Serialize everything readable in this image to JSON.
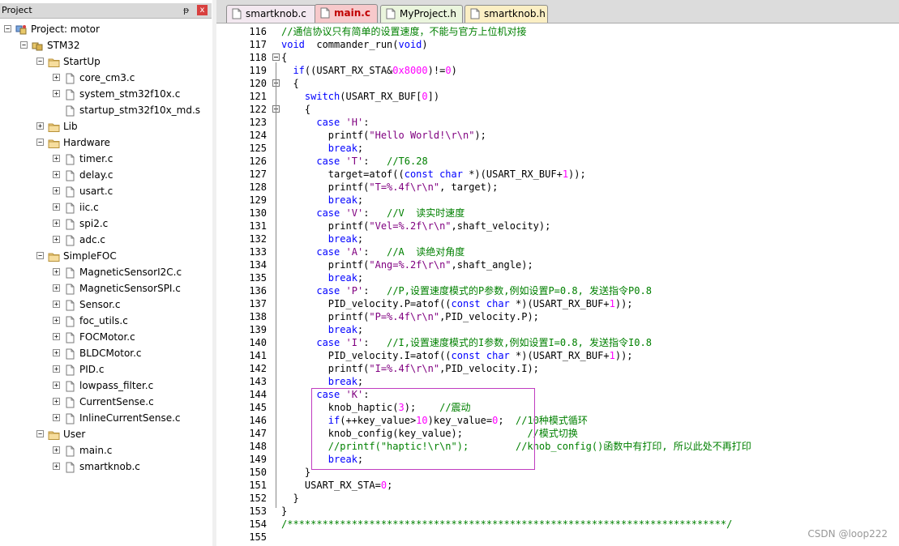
{
  "project_panel": {
    "title": "Project",
    "pin": "ᵽ",
    "close": "x",
    "tree": [
      {
        "label": "Project: motor",
        "type": "project",
        "depth": 0,
        "expander": "-"
      },
      {
        "label": "STM32",
        "type": "target",
        "depth": 1,
        "expander": "-"
      },
      {
        "label": "StartUp",
        "type": "folder",
        "depth": 2,
        "expander": "-"
      },
      {
        "label": "core_cm3.c",
        "type": "file",
        "depth": 3,
        "expander": "+"
      },
      {
        "label": "system_stm32f10x.c",
        "type": "file",
        "depth": 3,
        "expander": "+"
      },
      {
        "label": "startup_stm32f10x_md.s",
        "type": "file",
        "depth": 3,
        "expander": ""
      },
      {
        "label": "Lib",
        "type": "folder",
        "depth": 2,
        "expander": "+"
      },
      {
        "label": "Hardware",
        "type": "folder",
        "depth": 2,
        "expander": "-"
      },
      {
        "label": "timer.c",
        "type": "file",
        "depth": 3,
        "expander": "+"
      },
      {
        "label": "delay.c",
        "type": "file",
        "depth": 3,
        "expander": "+"
      },
      {
        "label": "usart.c",
        "type": "file",
        "depth": 3,
        "expander": "+"
      },
      {
        "label": "iic.c",
        "type": "file",
        "depth": 3,
        "expander": "+"
      },
      {
        "label": "spi2.c",
        "type": "file",
        "depth": 3,
        "expander": "+"
      },
      {
        "label": "adc.c",
        "type": "file",
        "depth": 3,
        "expander": "+"
      },
      {
        "label": "SimpleFOC",
        "type": "folder",
        "depth": 2,
        "expander": "-"
      },
      {
        "label": "MagneticSensorI2C.c",
        "type": "file",
        "depth": 3,
        "expander": "+"
      },
      {
        "label": "MagneticSensorSPI.c",
        "type": "file",
        "depth": 3,
        "expander": "+"
      },
      {
        "label": "Sensor.c",
        "type": "file",
        "depth": 3,
        "expander": "+"
      },
      {
        "label": "foc_utils.c",
        "type": "file",
        "depth": 3,
        "expander": "+"
      },
      {
        "label": "FOCMotor.c",
        "type": "file",
        "depth": 3,
        "expander": "+"
      },
      {
        "label": "BLDCMotor.c",
        "type": "file",
        "depth": 3,
        "expander": "+"
      },
      {
        "label": "PID.c",
        "type": "file",
        "depth": 3,
        "expander": "+"
      },
      {
        "label": "lowpass_filter.c",
        "type": "file",
        "depth": 3,
        "expander": "+"
      },
      {
        "label": "CurrentSense.c",
        "type": "file",
        "depth": 3,
        "expander": "+"
      },
      {
        "label": "InlineCurrentSense.c",
        "type": "file",
        "depth": 3,
        "expander": "+"
      },
      {
        "label": "User",
        "type": "folder",
        "depth": 2,
        "expander": "-"
      },
      {
        "label": "main.c",
        "type": "file",
        "depth": 3,
        "expander": "+"
      },
      {
        "label": "smartknob.c",
        "type": "file",
        "depth": 3,
        "expander": "+"
      }
    ]
  },
  "tabs": [
    {
      "label": "smartknob.c",
      "bg": "#f3e8f0",
      "active": false
    },
    {
      "label": "main.c",
      "bg": "#f7c9cb",
      "active": true
    },
    {
      "label": "MyProject.h",
      "bg": "#eaf5dd",
      "active": false
    },
    {
      "label": "smartknob.h",
      "bg": "#fbefc4",
      "active": false
    }
  ],
  "editor": {
    "lines": [
      {
        "n": "116",
        "fold": false,
        "parts": [
          [
            "cm",
            "//通信协议只有简单的设置速度，不能与官方上位机对接"
          ]
        ]
      },
      {
        "n": "117",
        "fold": false,
        "parts": [
          [
            "kw",
            "void"
          ],
          [
            "",
            "  commander_run("
          ],
          [
            "kw",
            "void"
          ],
          [
            "",
            ")"
          ]
        ]
      },
      {
        "n": "118",
        "fold": true,
        "parts": [
          [
            "",
            "{"
          ]
        ]
      },
      {
        "n": "119",
        "fold": false,
        "parts": [
          [
            "",
            "  "
          ],
          [
            "kw",
            "if"
          ],
          [
            "",
            "((USART_RX_STA&"
          ],
          [
            "num",
            "0x8000"
          ],
          [
            "",
            ")!="
          ],
          [
            "num",
            "0"
          ],
          [
            "",
            ")"
          ]
        ]
      },
      {
        "n": "120",
        "fold": true,
        "parts": [
          [
            "",
            "  {"
          ]
        ]
      },
      {
        "n": "121",
        "fold": false,
        "parts": [
          [
            "",
            "    "
          ],
          [
            "kw",
            "switch"
          ],
          [
            "",
            "(USART_RX_BUF["
          ],
          [
            "num",
            "0"
          ],
          [
            "",
            "])"
          ]
        ]
      },
      {
        "n": "122",
        "fold": true,
        "parts": [
          [
            "",
            "    {"
          ]
        ]
      },
      {
        "n": "123",
        "fold": false,
        "parts": [
          [
            "",
            "      "
          ],
          [
            "kw",
            "case"
          ],
          [
            "",
            " "
          ],
          [
            "str",
            "'H'"
          ],
          [
            "",
            ":"
          ]
        ]
      },
      {
        "n": "124",
        "fold": false,
        "parts": [
          [
            "",
            "        printf("
          ],
          [
            "str",
            "\"Hello World!\\r\\n\""
          ],
          [
            "",
            ");"
          ]
        ]
      },
      {
        "n": "125",
        "fold": false,
        "parts": [
          [
            "",
            "        "
          ],
          [
            "kw",
            "break"
          ],
          [
            "",
            ";"
          ]
        ]
      },
      {
        "n": "126",
        "fold": false,
        "parts": [
          [
            "",
            "      "
          ],
          [
            "kw",
            "case"
          ],
          [
            "",
            " "
          ],
          [
            "str",
            "'T'"
          ],
          [
            "",
            ":   "
          ],
          [
            "cm",
            "//T6.28"
          ]
        ]
      },
      {
        "n": "127",
        "fold": false,
        "parts": [
          [
            "",
            "        target=atof(("
          ],
          [
            "kw",
            "const"
          ],
          [
            "",
            " "
          ],
          [
            "kw",
            "char"
          ],
          [
            "",
            " *)(USART_RX_BUF+"
          ],
          [
            "num",
            "1"
          ],
          [
            "",
            "));"
          ]
        ]
      },
      {
        "n": "128",
        "fold": false,
        "parts": [
          [
            "",
            "        printf("
          ],
          [
            "str",
            "\"T=%.4f\\r\\n\""
          ],
          [
            "",
            ", target);"
          ]
        ]
      },
      {
        "n": "129",
        "fold": false,
        "parts": [
          [
            "",
            "        "
          ],
          [
            "kw",
            "break"
          ],
          [
            "",
            ";"
          ]
        ]
      },
      {
        "n": "130",
        "fold": false,
        "parts": [
          [
            "",
            "      "
          ],
          [
            "kw",
            "case"
          ],
          [
            "",
            " "
          ],
          [
            "str",
            "'V'"
          ],
          [
            "",
            ":   "
          ],
          [
            "cm",
            "//V  读实时速度"
          ]
        ]
      },
      {
        "n": "131",
        "fold": false,
        "parts": [
          [
            "",
            "        printf("
          ],
          [
            "str",
            "\"Vel=%.2f\\r\\n\""
          ],
          [
            "",
            ",shaft_velocity);"
          ]
        ]
      },
      {
        "n": "132",
        "fold": false,
        "parts": [
          [
            "",
            "        "
          ],
          [
            "kw",
            "break"
          ],
          [
            "",
            ";"
          ]
        ]
      },
      {
        "n": "133",
        "fold": false,
        "parts": [
          [
            "",
            "      "
          ],
          [
            "kw",
            "case"
          ],
          [
            "",
            " "
          ],
          [
            "str",
            "'A'"
          ],
          [
            "",
            ":   "
          ],
          [
            "cm",
            "//A  读绝对角度"
          ]
        ]
      },
      {
        "n": "134",
        "fold": false,
        "parts": [
          [
            "",
            "        printf("
          ],
          [
            "str",
            "\"Ang=%.2f\\r\\n\""
          ],
          [
            "",
            ",shaft_angle);"
          ]
        ]
      },
      {
        "n": "135",
        "fold": false,
        "parts": [
          [
            "",
            "        "
          ],
          [
            "kw",
            "break"
          ],
          [
            "",
            ";"
          ]
        ]
      },
      {
        "n": "136",
        "fold": false,
        "parts": [
          [
            "",
            "      "
          ],
          [
            "kw",
            "case"
          ],
          [
            "",
            " "
          ],
          [
            "str",
            "'P'"
          ],
          [
            "",
            ":   "
          ],
          [
            "cm",
            "//P,设置速度模式的P参数,例如设置P=0.8, 发送指令P0.8"
          ]
        ]
      },
      {
        "n": "137",
        "fold": false,
        "parts": [
          [
            "",
            "        PID_velocity.P=atof(("
          ],
          [
            "kw",
            "const"
          ],
          [
            "",
            " "
          ],
          [
            "kw",
            "char"
          ],
          [
            "",
            " *)(USART_RX_BUF+"
          ],
          [
            "num",
            "1"
          ],
          [
            "",
            "));"
          ]
        ]
      },
      {
        "n": "138",
        "fold": false,
        "parts": [
          [
            "",
            "        printf("
          ],
          [
            "str",
            "\"P=%.4f\\r\\n\""
          ],
          [
            "",
            ",PID_velocity.P);"
          ]
        ]
      },
      {
        "n": "139",
        "fold": false,
        "parts": [
          [
            "",
            "        "
          ],
          [
            "kw",
            "break"
          ],
          [
            "",
            ";"
          ]
        ]
      },
      {
        "n": "140",
        "fold": false,
        "parts": [
          [
            "",
            "      "
          ],
          [
            "kw",
            "case"
          ],
          [
            "",
            " "
          ],
          [
            "str",
            "'I'"
          ],
          [
            "",
            ":   "
          ],
          [
            "cm",
            "//I,设置速度模式的I参数,例如设置I=0.8, 发送指令I0.8"
          ]
        ]
      },
      {
        "n": "141",
        "fold": false,
        "parts": [
          [
            "",
            "        PID_velocity.I=atof(("
          ],
          [
            "kw",
            "const"
          ],
          [
            "",
            " "
          ],
          [
            "kw",
            "char"
          ],
          [
            "",
            " *)(USART_RX_BUF+"
          ],
          [
            "num",
            "1"
          ],
          [
            "",
            "));"
          ]
        ]
      },
      {
        "n": "142",
        "fold": false,
        "parts": [
          [
            "",
            "        printf("
          ],
          [
            "str",
            "\"I=%.4f\\r\\n\""
          ],
          [
            "",
            ",PID_velocity.I);"
          ]
        ]
      },
      {
        "n": "143",
        "fold": false,
        "parts": [
          [
            "",
            "        "
          ],
          [
            "kw",
            "break"
          ],
          [
            "",
            ";"
          ]
        ]
      },
      {
        "n": "144",
        "fold": false,
        "parts": [
          [
            "",
            "      "
          ],
          [
            "kw",
            "case"
          ],
          [
            "",
            " "
          ],
          [
            "str",
            "'K'"
          ],
          [
            "",
            ":"
          ]
        ]
      },
      {
        "n": "145",
        "fold": false,
        "parts": [
          [
            "",
            "        knob_haptic("
          ],
          [
            "num",
            "3"
          ],
          [
            "",
            ");    "
          ],
          [
            "cm",
            "//震动"
          ]
        ]
      },
      {
        "n": "146",
        "fold": false,
        "parts": [
          [
            "",
            "        "
          ],
          [
            "kw",
            "if"
          ],
          [
            "",
            "(++key_value>"
          ],
          [
            "num",
            "10"
          ],
          [
            "",
            ")key_value="
          ],
          [
            "num",
            "0"
          ],
          [
            "",
            ";  "
          ],
          [
            "cm",
            "//10种模式循环"
          ]
        ]
      },
      {
        "n": "147",
        "fold": false,
        "parts": [
          [
            "",
            "        knob_config(key_value);           "
          ],
          [
            "cm",
            "//模式切换"
          ]
        ]
      },
      {
        "n": "148",
        "fold": false,
        "parts": [
          [
            "",
            "        "
          ],
          [
            "cm",
            "//printf(\"haptic!\\r\\n\");"
          ],
          [
            "",
            "        "
          ],
          [
            "cm",
            "//knob_config()函数中有打印, 所以此处不再打印"
          ]
        ]
      },
      {
        "n": "149",
        "fold": false,
        "parts": [
          [
            "",
            "        "
          ],
          [
            "kw",
            "break"
          ],
          [
            "",
            ";"
          ]
        ]
      },
      {
        "n": "150",
        "fold": false,
        "parts": [
          [
            "",
            "    }"
          ]
        ]
      },
      {
        "n": "151",
        "fold": false,
        "parts": [
          [
            "",
            "    USART_RX_STA="
          ],
          [
            "num",
            "0"
          ],
          [
            "",
            ";"
          ]
        ]
      },
      {
        "n": "152",
        "fold": false,
        "parts": [
          [
            "",
            "  }"
          ]
        ]
      },
      {
        "n": "153",
        "fold": false,
        "parts": [
          [
            "",
            "}"
          ]
        ]
      },
      {
        "n": "154",
        "fold": false,
        "parts": [
          [
            "cm",
            "/***************************************************************************/"
          ]
        ]
      },
      {
        "n": "155",
        "fold": false,
        "parts": []
      }
    ]
  },
  "watermark": "CSDN @loop222"
}
